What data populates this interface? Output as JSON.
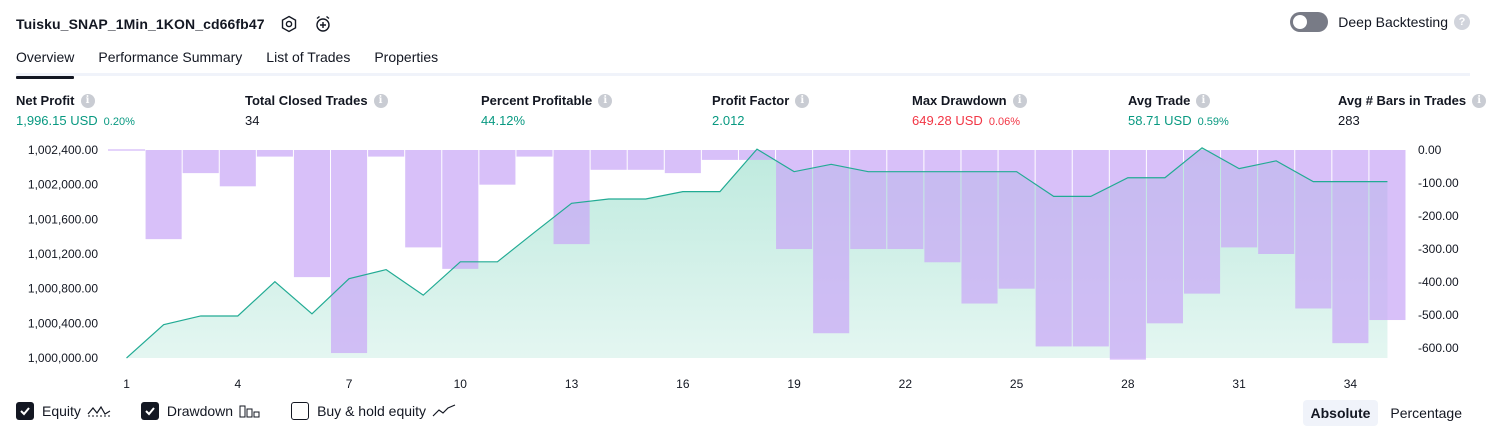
{
  "header": {
    "strategy_name": "Tuisku_SNAP_1Min_1KON_cd66fb47",
    "settings_icon": "hexagon-gear-icon",
    "alert_icon": "alarm-clock-plus-icon"
  },
  "deep_backtesting": {
    "label": "Deep Backtesting",
    "enabled": false,
    "help": "?"
  },
  "tabs": [
    {
      "label": "Overview",
      "active": true
    },
    {
      "label": "Performance Summary",
      "active": false
    },
    {
      "label": "List of Trades",
      "active": false
    },
    {
      "label": "Properties",
      "active": false
    }
  ],
  "metrics": {
    "net_profit": {
      "label": "Net Profit",
      "value": "1,996.15 USD",
      "pct": "0.20%"
    },
    "total_closed_trades": {
      "label": "Total Closed Trades",
      "value": "34"
    },
    "percent_profitable": {
      "label": "Percent Profitable",
      "value": "44.12%"
    },
    "profit_factor": {
      "label": "Profit Factor",
      "value": "2.012"
    },
    "max_drawdown": {
      "label": "Max Drawdown",
      "value": "649.28 USD",
      "pct": "0.06%"
    },
    "avg_trade": {
      "label": "Avg Trade",
      "value": "58.71 USD",
      "pct": "0.59%"
    },
    "avg_bars": {
      "label": "Avg # Bars in Trades",
      "value": "283"
    }
  },
  "info_glyph": "i",
  "colors": {
    "positive": "#089981",
    "negative": "#f23645",
    "equity_line": "#22ab94",
    "equity_fill_top": "#b2e6d8",
    "drawdown_bar": "#c9a7f7"
  },
  "chart_data": {
    "type": "area",
    "x": [
      1,
      2,
      3,
      4,
      5,
      6,
      7,
      8,
      9,
      10,
      11,
      12,
      13,
      14,
      15,
      16,
      17,
      18,
      19,
      20,
      21,
      22,
      23,
      24,
      25,
      26,
      27,
      28,
      29,
      30,
      31,
      32,
      33,
      34,
      35
    ],
    "x_ticks": [
      "1",
      "4",
      "7",
      "10",
      "13",
      "16",
      "19",
      "22",
      "25",
      "28",
      "31",
      "34"
    ],
    "y_left_ticks": [
      "1,002,400.00",
      "1,002,000.00",
      "1,001,600.00",
      "1,001,200.00",
      "1,000,800.00",
      "1,000,400.00",
      "1,000,000.00"
    ],
    "y_right_ticks": [
      "0.00",
      "-100.00",
      "-200.00",
      "-300.00",
      "-400.00",
      "-500.00",
      "-600.00"
    ],
    "ylim_left": [
      1000000,
      1002400
    ],
    "ylim_right": [
      -630,
      0
    ],
    "series": [
      {
        "axis": "left",
        "kind": "line-area",
        "values": [
          1000000,
          1000385,
          1000485,
          1000485,
          1000880,
          1000510,
          1000915,
          1001020,
          1000725,
          1001110,
          1001110,
          1001450,
          1001785,
          1001835,
          1001835,
          1001920,
          1001920,
          1002410,
          1002150,
          1002235,
          1002150,
          1002150,
          1002150,
          1002150,
          1002150,
          1001865,
          1001865,
          1002080,
          1002080,
          1002425,
          1002185,
          1002275,
          1002035,
          1002035,
          1002035
        ]
      },
      {
        "axis": "right",
        "kind": "bar",
        "values": [
          0,
          -270,
          -70,
          -110,
          -20,
          -385,
          -615,
          -20,
          -295,
          -360,
          -105,
          -20,
          -285,
          -60,
          -60,
          -70,
          -30,
          -30,
          -300,
          -555,
          -300,
          -300,
          -340,
          -465,
          -420,
          -595,
          -595,
          -635,
          -525,
          -435,
          -295,
          -315,
          -480,
          -585,
          -515
        ]
      }
    ],
    "legend": [
      {
        "label": "Equity",
        "checked": true,
        "icon": "equity-line-icon"
      },
      {
        "label": "Drawdown",
        "checked": true,
        "icon": "drawdown-bars-icon"
      },
      {
        "label": "Buy & hold equity",
        "checked": false,
        "icon": "buyhold-line-icon"
      }
    ],
    "grid": false
  },
  "mode": {
    "absolute": "Absolute",
    "percentage": "Percentage",
    "selected": "Absolute"
  }
}
